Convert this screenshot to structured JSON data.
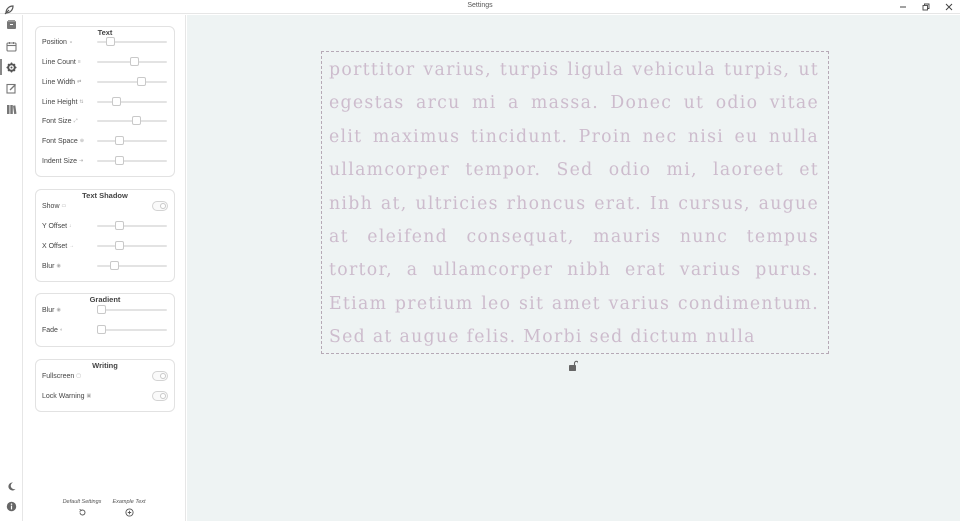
{
  "window": {
    "title": "Settings"
  },
  "settings_panel": {
    "groups": [
      {
        "title": "Text",
        "rows": [
          {
            "label": "Position",
            "icon": "position-icon",
            "value": 0.15
          },
          {
            "label": "Line Count",
            "icon": "line-count-icon",
            "value": 0.53
          },
          {
            "label": "Line Width",
            "icon": "line-width-icon",
            "value": 0.65
          },
          {
            "label": "Line Height",
            "icon": "line-height-icon",
            "value": 0.24
          },
          {
            "label": "Font Size",
            "icon": "font-size-icon",
            "value": 0.56
          },
          {
            "label": "Font Space",
            "icon": "font-space-icon",
            "value": 0.29
          },
          {
            "label": "Indent Size",
            "icon": "indent-size-icon",
            "value": 0.29
          }
        ]
      },
      {
        "title": "Text Shadow",
        "rows": [
          {
            "label": "Show",
            "icon": "show-icon",
            "toggle": "on"
          },
          {
            "label": "Y Offset",
            "icon": "y-offset-icon",
            "value": 0.29
          },
          {
            "label": "X Offset",
            "icon": "x-offset-icon",
            "value": 0.29
          },
          {
            "label": "Blur",
            "icon": "blur-icon",
            "value": 0.21
          }
        ]
      },
      {
        "title": "Gradient",
        "rows": [
          {
            "label": "Blur",
            "icon": "blur-icon",
            "value": 0.0
          },
          {
            "label": "Fade",
            "icon": "fade-icon",
            "value": 0.0
          }
        ]
      },
      {
        "title": "Writing",
        "rows": [
          {
            "label": "Fullscreen",
            "icon": "fullscreen-icon",
            "toggle": "on"
          },
          {
            "label": "Lock Warning",
            "icon": "lock-warning-icon",
            "toggle": "on"
          }
        ]
      }
    ],
    "footer": {
      "default_settings_label": "Default Settings",
      "example_text_label": "Example Text"
    }
  },
  "preview": {
    "text": "porttitor varius, turpis ligula vehicula turpis, ut egestas arcu mi a massa. Donec ut odio vitae elit maximus tincidunt. Proin nec nisi eu nulla ullamcorper tempor. Sed odio mi, laoreet et nibh at, ultricies rhoncus erat. In cursus, augue at eleifend consequat, mauris nunc tempus tortor, a ullamcorper nibh erat varius purus. Etiam pretium leo sit amet varius condimentum. Sed at augue felis. Morbi sed dictum nulla"
  },
  "colors": {
    "main_background": "#eef3f3",
    "preview_text": "#cdbccd",
    "frame_border": "#b6a9b6"
  }
}
